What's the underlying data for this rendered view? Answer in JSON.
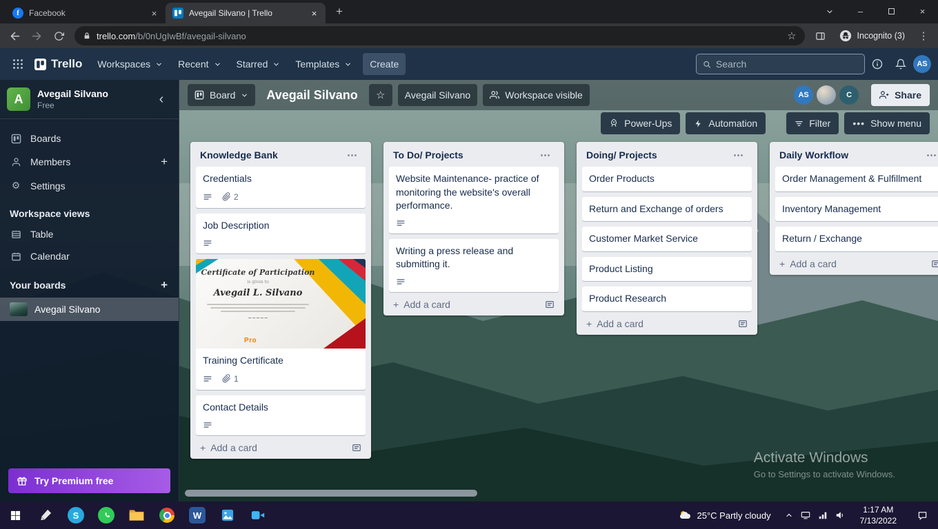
{
  "browser": {
    "tab1": "Facebook",
    "tab2": "Avegail Silvano | Trello",
    "url_domain": "trello.com",
    "url_path": "/b/0nUgIwBf/avegail-silvano",
    "incognito": "Incognito (3)"
  },
  "header": {
    "logo": "Trello",
    "workspaces": "Workspaces",
    "recent": "Recent",
    "starred": "Starred",
    "templates": "Templates",
    "create": "Create",
    "search_placeholder": "Search",
    "avatar": "AS"
  },
  "sidebar": {
    "workspace_initial": "A",
    "workspace_name": "Avegail Silvano",
    "workspace_plan": "Free",
    "boards": "Boards",
    "members": "Members",
    "settings": "Settings",
    "views_header": "Workspace views",
    "table": "Table",
    "calendar": "Calendar",
    "your_boards": "Your boards",
    "board_name": "Avegail Silvano",
    "premium": "Try Premium free"
  },
  "board": {
    "menu": "Board",
    "title": "Avegail Silvano",
    "workspace_chip": "Avegail Silvano",
    "visibility": "Workspace visible",
    "member1": "AS",
    "member3": "C",
    "share": "Share",
    "powerups": "Power-Ups",
    "automation": "Automation",
    "filter": "Filter",
    "show_menu": "Show menu"
  },
  "lists": [
    {
      "title": "Knowledge Bank",
      "add_label": "Add a card",
      "cards": [
        {
          "title": "Credentials",
          "attachments": "2"
        },
        {
          "title": "Job Description"
        },
        {
          "title": "Training Certificate",
          "attachments": "1"
        },
        {
          "title": "Contact Details"
        }
      ]
    },
    {
      "title": "To Do/ Projects",
      "add_label": "Add a card",
      "cards": [
        {
          "title": "Website Maintenance- practice of monitoring the website's overall performance."
        },
        {
          "title": "Writing a press release and submitting it."
        }
      ]
    },
    {
      "title": "Doing/ Projects",
      "add_label": "Add a card",
      "cards": [
        {
          "title": "Order Products"
        },
        {
          "title": "Return and Exchange of orders"
        },
        {
          "title": "Customer Market Service"
        },
        {
          "title": "Product Listing"
        },
        {
          "title": "Product Research"
        }
      ]
    },
    {
      "title": "Daily Workflow",
      "add_label": "Add a card",
      "cards": [
        {
          "title": "Order Management & Fulfillment"
        },
        {
          "title": "Inventory Management"
        },
        {
          "title": "Return / Exchange"
        }
      ]
    }
  ],
  "certificate": {
    "title": "Certificate of Participation",
    "given": "is given to",
    "name": "Avegail L. Silvano",
    "logo": "Pro"
  },
  "watermark": {
    "line1": "Activate Windows",
    "line2": "Go to Settings to activate Windows."
  },
  "taskbar": {
    "weather": "25°C Partly cloudy",
    "time": "1:17 AM",
    "date": "7/13/2022"
  },
  "colors": {
    "member_avatar_blue": "#3178be",
    "workspace_avatar_green": "#55a14e",
    "premium_gradient_start": "#7b2fd1",
    "premium_gradient_end": "#a75ce6",
    "list_background": "#ebecf0"
  }
}
